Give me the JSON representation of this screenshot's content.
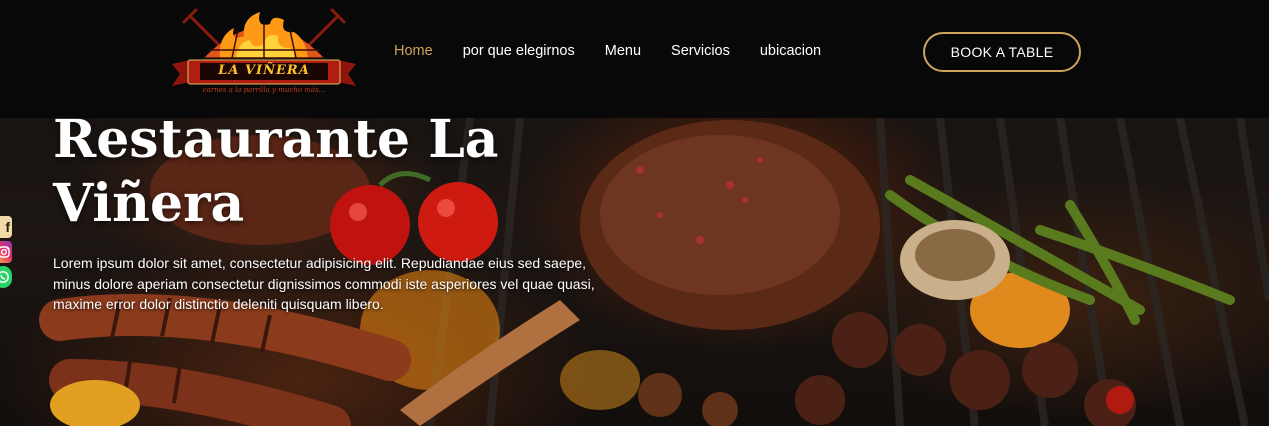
{
  "brand": {
    "logo_text": "LA VIÑERA",
    "tagline": "carnes a la parrilla y mucho más...",
    "colors": {
      "flame_orange": "#f2620f",
      "flame_yellow": "#ffc226",
      "banner_red": "#b01e12"
    }
  },
  "nav": {
    "links": [
      {
        "label": "Home",
        "active": true
      },
      {
        "label": "por que elegirnos",
        "active": false
      },
      {
        "label": "Menu",
        "active": false
      },
      {
        "label": "Servicios",
        "active": false
      },
      {
        "label": "ubicacion",
        "active": false
      }
    ],
    "cta_label": "BOOK A TABLE",
    "accent_color": "#cda45e"
  },
  "hero": {
    "title": "Restaurante La Viñera",
    "description": "Lorem ipsum dolor sit amet, consectetur adipisicing elit. Repudiandae eius sed saepe, minus dolore aperiam consectetur dignissimos commodi iste asperiores vel quae quasi, maxime error dolor distinctio deleniti quisquam libero."
  },
  "social": {
    "icons": [
      "facebook-icon",
      "instagram-icon",
      "whatsapp-icon"
    ],
    "facebook_glyph": "f"
  }
}
